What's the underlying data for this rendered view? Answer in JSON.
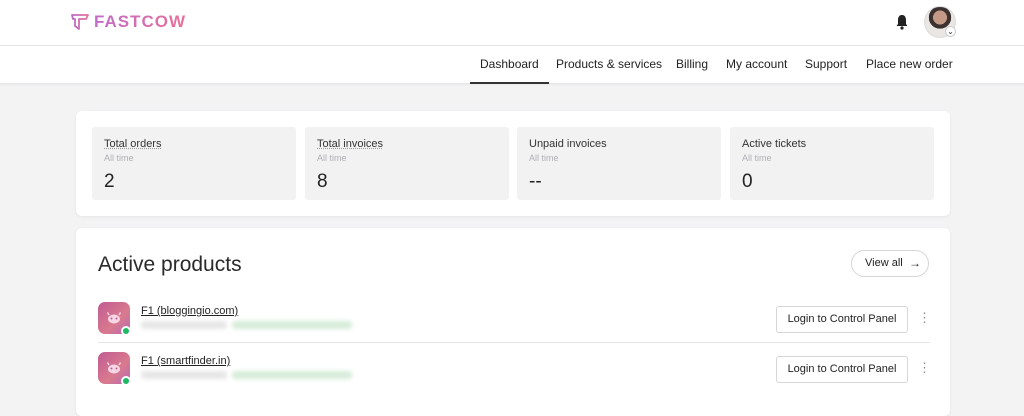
{
  "brand": {
    "name": "FASTCOW",
    "accent": "#d86a9e"
  },
  "header": {
    "notification_icon": "bell-icon",
    "avatar_icon": "user-avatar"
  },
  "nav": {
    "items": [
      {
        "label": "Dashboard",
        "active": true
      },
      {
        "label": "Products & services",
        "active": false
      },
      {
        "label": "Billing",
        "active": false
      },
      {
        "label": "My account",
        "active": false
      },
      {
        "label": "Support",
        "active": false
      },
      {
        "label": "Place new order",
        "active": false
      }
    ]
  },
  "stats": [
    {
      "label": "Total orders",
      "sublabel": "All time",
      "value": "2"
    },
    {
      "label": "Total invoices",
      "sublabel": "All time",
      "value": "8"
    },
    {
      "label": "Unpaid invoices",
      "sublabel": "All time",
      "value": "--"
    },
    {
      "label": "Active tickets",
      "sublabel": "All time",
      "value": "0"
    }
  ],
  "products": {
    "title": "Active products",
    "view_all_label": "View all",
    "items": [
      {
        "name": "F1 (bloggingio.com)",
        "status_color": "#1fb964",
        "action_label": "Login to Control Panel"
      },
      {
        "name": "F1 (smartfinder.in)",
        "status_color": "#1fb964",
        "action_label": "Login to Control Panel"
      }
    ]
  }
}
